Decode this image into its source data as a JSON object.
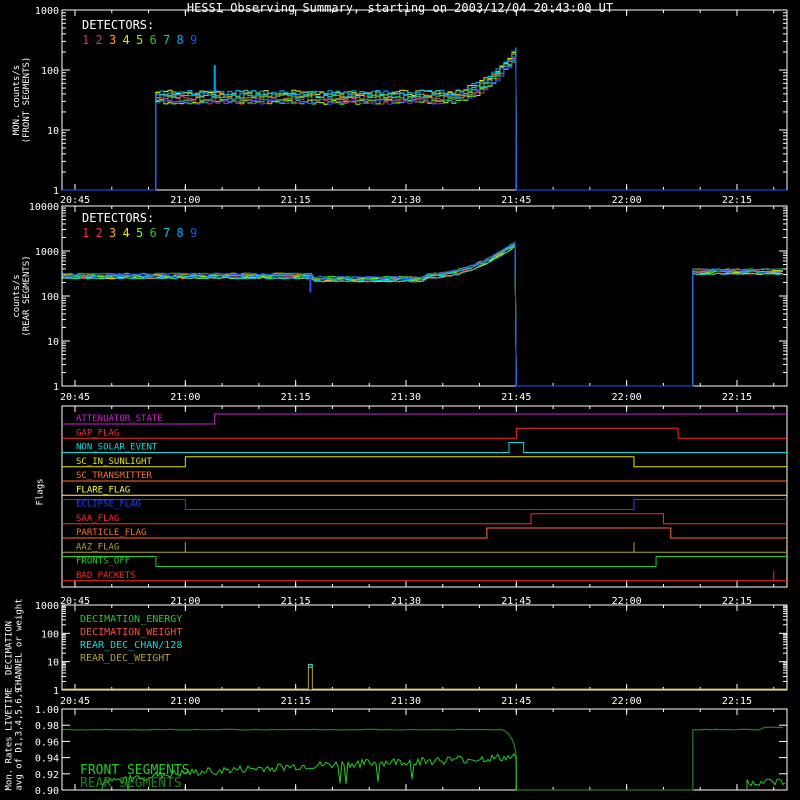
{
  "title": "HESSI Observing Summary, starting on 2003/12/04 20:43:00 UT",
  "time_ticks": [
    "20:45",
    "21:00",
    "21:15",
    "21:30",
    "21:45",
    "22:00",
    "22:15"
  ],
  "detector_colors": [
    "#ff2a2a",
    "#e0306f",
    "#ffa500",
    "#e6e600",
    "#7cfc00",
    "#30c030",
    "#00c8c8",
    "#00aaff",
    "#2050ff"
  ],
  "chart_data": [
    {
      "type": "line",
      "panel": "front",
      "ylabel": "MON. counts/s\n(FRONT SEGMENTS)",
      "ylim": [
        1,
        1000
      ],
      "yscale": "log",
      "y_ticks": [
        "1",
        "10",
        "100",
        "1000"
      ],
      "legend_title": "DETECTORS:",
      "legend_items": [
        "1",
        "2",
        "3",
        "4",
        "5",
        "6",
        "7",
        "8",
        "9"
      ],
      "data_start": "20:56",
      "data_end": "21:45",
      "level": 35,
      "end_level": 200,
      "spike_time": "21:04",
      "spike_value": 120
    },
    {
      "type": "line",
      "panel": "rear",
      "ylabel": "counts/s\n(REAR SEGMENTS)",
      "ylim": [
        1,
        10000
      ],
      "yscale": "log",
      "y_ticks": [
        "1",
        "10",
        "100",
        "1000",
        "10000"
      ],
      "legend_title": "DETECTORS:",
      "legend_items": [
        "1",
        "2",
        "3",
        "4",
        "5",
        "6",
        "7",
        "8",
        "9"
      ],
      "data_start": "20:45",
      "data_end": "21:45",
      "level": 280,
      "end_level": 1500,
      "resume_time": "22:09",
      "resume_level": 350,
      "dip_time": "21:17",
      "dip_value": 120
    },
    {
      "type": "line",
      "panel": "flags",
      "ylabel": "Flags",
      "flags": [
        {
          "name": "ATTENUATOR_STATE",
          "color": "#d020d0"
        },
        {
          "name": "GAP_FLAG",
          "color": "#ff2a2a"
        },
        {
          "name": "NON_SOLAR_EVENT",
          "color": "#00e0e0"
        },
        {
          "name": "SC_IN_SUNLIGHT",
          "color": "#e6e600"
        },
        {
          "name": "SC_TRANSMITTER",
          "color": "#ff7030"
        },
        {
          "name": "FLARE_FLAG",
          "color": "#ffff40"
        },
        {
          "name": "ECLIPSE_FLAG",
          "color": "#2040ff"
        },
        {
          "name": "SAA_FLAG",
          "color": "#ff2a2a"
        },
        {
          "name": "PARTICLE_FLAG",
          "color": "#ff7030"
        },
        {
          "name": "AAZ_FLAG",
          "color": "#b0a030"
        },
        {
          "name": "FRONTS_OFF",
          "color": "#20d020"
        },
        {
          "name": "BAD_PACKETS",
          "color": "#ff2a2a"
        }
      ]
    },
    {
      "type": "line",
      "panel": "decimation",
      "ylabel": "DECIMATION\nCHANNEL or weight",
      "ylim": [
        1,
        1000
      ],
      "yscale": "log",
      "y_ticks": [
        "1",
        "10",
        "100",
        "1000"
      ],
      "legend": [
        {
          "name": "DECIMATION_ENERGY",
          "color": "#20d020"
        },
        {
          "name": "DECIMATION_WEIGHT",
          "color": "#ff5030"
        },
        {
          "name": "REAR_DEC_CHAN/128",
          "color": "#00e0e0"
        },
        {
          "name": "REAR_DEC_WEIGHT",
          "color": "#b0a030"
        }
      ],
      "spike_time": "21:17",
      "spike_value": 8
    },
    {
      "type": "line",
      "panel": "livetime",
      "ylabel": "Mon. Rates LIVETIME\navg of D1,3,4,5,6,9",
      "ylim": [
        0.9,
        1.0
      ],
      "y_ticks": [
        "0.90",
        "0.92",
        "0.94",
        "0.96",
        "0.98",
        "1.00"
      ],
      "legend": [
        {
          "name": "FRONT SEGMENTS",
          "color": "#20d020"
        },
        {
          "name": "REAR SEGMENTS",
          "color": "#208020"
        }
      ],
      "rear_level": 0.975,
      "front_level": 0.935
    }
  ]
}
